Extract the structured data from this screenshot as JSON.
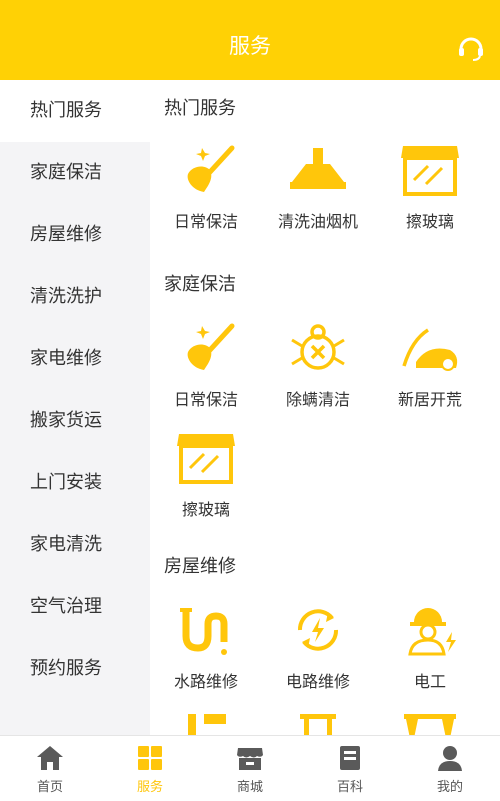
{
  "header": {
    "title": "服务"
  },
  "colors": {
    "accent": "#FFD105",
    "icon": "#FFC60B",
    "sidebar_bg": "#F4F4F6"
  },
  "sidebar": {
    "items": [
      {
        "label": "热门服务",
        "active": true
      },
      {
        "label": "家庭保洁"
      },
      {
        "label": "房屋维修"
      },
      {
        "label": "清洗洗护"
      },
      {
        "label": "家电维修"
      },
      {
        "label": "搬家货运"
      },
      {
        "label": "上门安装"
      },
      {
        "label": "家电清洗"
      },
      {
        "label": "空气治理"
      },
      {
        "label": "预约服务"
      }
    ]
  },
  "sections": [
    {
      "title": "热门服务",
      "items": [
        {
          "label": "日常保洁",
          "icon": "broom-icon"
        },
        {
          "label": "清洗油烟机",
          "icon": "range-hood-icon"
        },
        {
          "label": "擦玻璃",
          "icon": "window-icon"
        }
      ]
    },
    {
      "title": "家庭保洁",
      "items": [
        {
          "label": "日常保洁",
          "icon": "broom-icon"
        },
        {
          "label": "除螨清洁",
          "icon": "mite-icon"
        },
        {
          "label": "新居开荒",
          "icon": "vacuum-icon"
        },
        {
          "label": "擦玻璃",
          "icon": "window-icon"
        }
      ]
    },
    {
      "title": "房屋维修",
      "items": [
        {
          "label": "水路维修",
          "icon": "pipe-icon"
        },
        {
          "label": "电路维修",
          "icon": "electric-circuit-icon"
        },
        {
          "label": "电工",
          "icon": "electrician-icon"
        }
      ]
    }
  ],
  "tabs": [
    {
      "label": "首页",
      "icon": "home-icon"
    },
    {
      "label": "服务",
      "icon": "grid-icon",
      "active": true
    },
    {
      "label": "商城",
      "icon": "store-icon"
    },
    {
      "label": "百科",
      "icon": "book-icon"
    },
    {
      "label": "我的",
      "icon": "user-icon"
    }
  ]
}
